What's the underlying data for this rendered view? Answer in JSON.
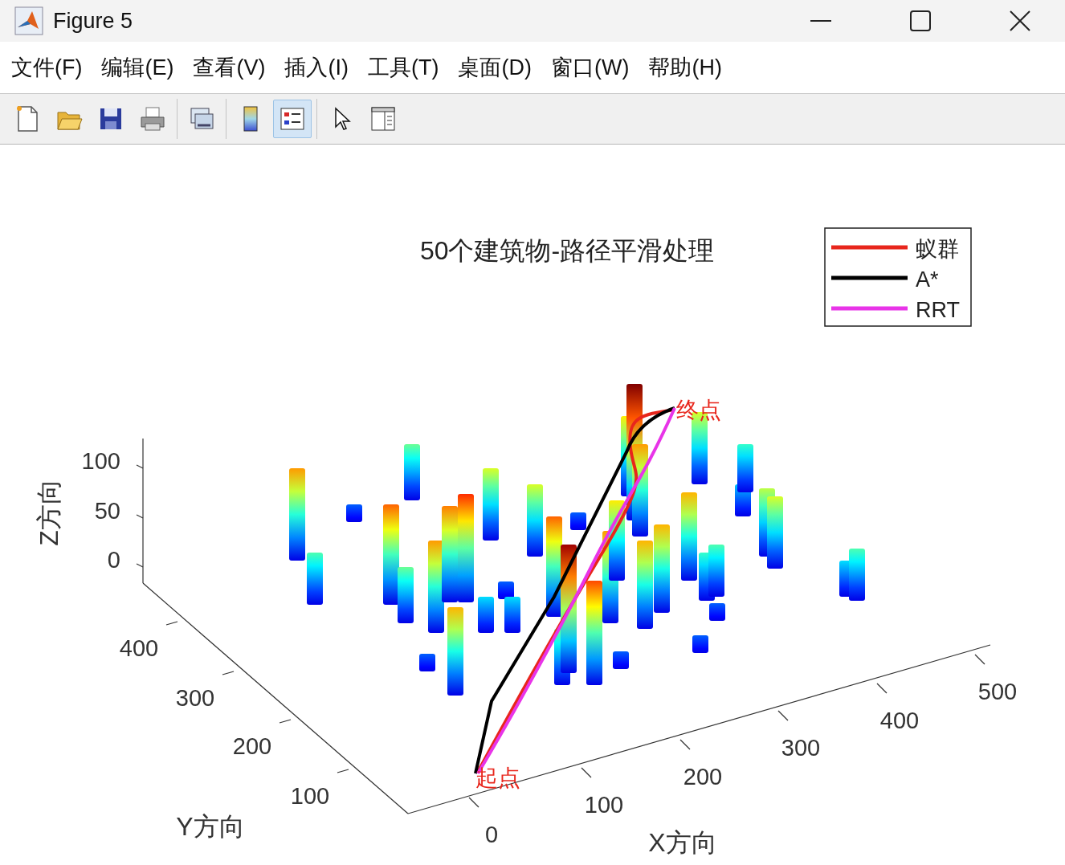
{
  "window": {
    "title": "Figure 5"
  },
  "menu": [
    {
      "label": "文件(F)"
    },
    {
      "label": "编辑(E)"
    },
    {
      "label": "查看(V)"
    },
    {
      "label": "插入(I)"
    },
    {
      "label": "工具(T)"
    },
    {
      "label": "桌面(D)"
    },
    {
      "label": "窗口(W)"
    },
    {
      "label": "帮助(H)"
    }
  ],
  "toolbar": [
    [
      {
        "kind": "new",
        "selected": false
      },
      {
        "kind": "open",
        "selected": false
      },
      {
        "kind": "save",
        "selected": false
      },
      {
        "kind": "print",
        "selected": false
      }
    ],
    [
      {
        "kind": "link",
        "selected": false
      }
    ],
    [
      {
        "kind": "colorbar",
        "selected": false
      },
      {
        "kind": "legend",
        "selected": true
      }
    ],
    [
      {
        "kind": "pointer",
        "selected": false
      },
      {
        "kind": "panel",
        "selected": false
      }
    ]
  ],
  "plot": {
    "title": "50个建筑物-路径平滑处理",
    "legend": [
      {
        "label": "蚁群",
        "color": "#e8261c"
      },
      {
        "label": "A*",
        "color": "#000000"
      },
      {
        "label": "RRT",
        "color": "#e834e8"
      }
    ],
    "zlabel": "Z方向",
    "ylabel": "Y方向",
    "xlabel": "X方向",
    "z_ticks": [
      "100",
      "50",
      "0"
    ],
    "y_ticks": [
      "400",
      "300",
      "200",
      "100"
    ],
    "x_ticks": [
      "0",
      "100",
      "200",
      "300",
      "400",
      "500"
    ],
    "end_label": "终点",
    "start_label": "起点"
  }
}
